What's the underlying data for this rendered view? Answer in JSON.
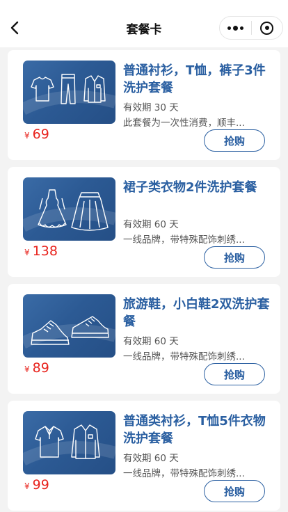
{
  "header": {
    "title": "套餐卡"
  },
  "currency": "¥",
  "buy_label": "抢购",
  "cards": [
    {
      "name": "普通衬衫，T恤，裤子3件洗护套餐",
      "validity": "有效期 30 天",
      "desc": "此套餐为一次性消费，顺丰...",
      "price": "69",
      "image_icons": [
        "tshirt-icon",
        "trousers-icon",
        "shirt-icon"
      ]
    },
    {
      "name": "裙子类衣物2件洗护套餐",
      "validity": "有效期 60 天",
      "desc": "一线品牌，带特殊配饰刺绣...",
      "price": "138",
      "image_icons": [
        "dress-icon",
        "skirt-icon"
      ]
    },
    {
      "name": "旅游鞋，小白鞋2双洗护套餐",
      "validity": "有效期 60 天",
      "desc": "一线品牌，带特殊配饰刺绣...",
      "price": "89",
      "image_icons": [
        "sneaker-icon",
        "sneaker-icon"
      ]
    },
    {
      "name": "普通类衬衫，T恤5件衣物洗护套餐",
      "validity": "有效期 60 天",
      "desc": "一线品牌，带特殊配饰刺绣...",
      "price": "99",
      "image_icons": [
        "polo-shirt-icon",
        "shirt-icon"
      ]
    }
  ],
  "colors": {
    "accent": "#2a5fa1",
    "price": "#e8231d",
    "thumb_bg": "#2c5a94"
  }
}
